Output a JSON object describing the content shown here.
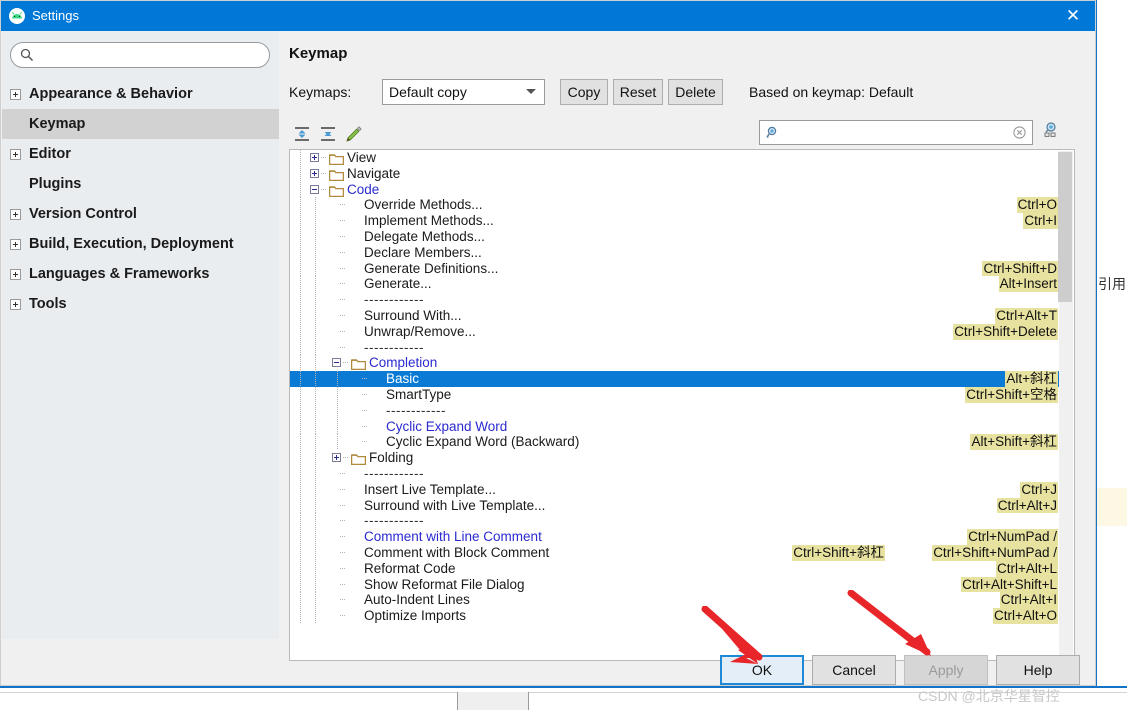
{
  "window": {
    "title": "Settings",
    "app_icon": "android-studio-icon",
    "close_label": "✕"
  },
  "sidebar": {
    "search": {
      "value": "",
      "placeholder": "",
      "icon": "search-icon"
    },
    "items": [
      {
        "label": "Appearance & Behavior",
        "expandable": true,
        "selected": false
      },
      {
        "label": "Keymap",
        "expandable": false,
        "selected": true
      },
      {
        "label": "Editor",
        "expandable": true,
        "selected": false
      },
      {
        "label": "Plugins",
        "expandable": false,
        "selected": false
      },
      {
        "label": "Version Control",
        "expandable": true,
        "selected": false
      },
      {
        "label": "Build, Execution, Deployment",
        "expandable": true,
        "selected": false
      },
      {
        "label": "Languages & Frameworks",
        "expandable": true,
        "selected": false
      },
      {
        "label": "Tools",
        "expandable": true,
        "selected": false
      }
    ]
  },
  "main": {
    "title": "Keymap",
    "keymaps_label": "Keymaps:",
    "keymap_selected": "Default copy",
    "buttons": {
      "copy": "Copy",
      "reset": "Reset",
      "delete": "Delete"
    },
    "based_on": "Based on keymap: Default",
    "toolbar_icons": [
      "expand-all-icon",
      "collapse-all-icon",
      "edit-shortcut-icon"
    ],
    "find": {
      "value": "",
      "placeholder": "",
      "icon": "find-shortcut-icon",
      "clear_icon": "clear-icon",
      "filter_icon": "filter-by-shortcut-icon"
    }
  },
  "tree": {
    "rows": [
      {
        "kind": "folder",
        "label": "View",
        "depth": 1,
        "toggle": "plus",
        "color": "dark",
        "shortcut": ""
      },
      {
        "kind": "folder",
        "label": "Navigate",
        "depth": 1,
        "toggle": "plus",
        "color": "dark",
        "shortcut": ""
      },
      {
        "kind": "folder",
        "label": "Code",
        "depth": 1,
        "toggle": "minus",
        "color": "blue",
        "shortcut": ""
      },
      {
        "kind": "item",
        "label": "Override Methods...",
        "depth": 2,
        "toggle": "",
        "color": "dark",
        "shortcut": "Ctrl+O"
      },
      {
        "kind": "item",
        "label": "Implement Methods...",
        "depth": 2,
        "toggle": "",
        "color": "dark",
        "shortcut": "Ctrl+I"
      },
      {
        "kind": "item",
        "label": "Delegate Methods...",
        "depth": 2,
        "toggle": "",
        "color": "dark",
        "shortcut": ""
      },
      {
        "kind": "item",
        "label": "Declare Members...",
        "depth": 2,
        "toggle": "",
        "color": "dark",
        "shortcut": ""
      },
      {
        "kind": "item",
        "label": "Generate Definitions...",
        "depth": 2,
        "toggle": "",
        "color": "dark",
        "shortcut": "Ctrl+Shift+D"
      },
      {
        "kind": "item",
        "label": "Generate...",
        "depth": 2,
        "toggle": "",
        "color": "dark",
        "shortcut": "Alt+Insert"
      },
      {
        "kind": "sep",
        "label": "------------",
        "depth": 2,
        "toggle": "",
        "color": "dark",
        "shortcut": ""
      },
      {
        "kind": "item",
        "label": "Surround With...",
        "depth": 2,
        "toggle": "",
        "color": "dark",
        "shortcut": "Ctrl+Alt+T"
      },
      {
        "kind": "item",
        "label": "Unwrap/Remove...",
        "depth": 2,
        "toggle": "",
        "color": "dark",
        "shortcut": "Ctrl+Shift+Delete"
      },
      {
        "kind": "sep",
        "label": "------------",
        "depth": 2,
        "toggle": "",
        "color": "dark",
        "shortcut": ""
      },
      {
        "kind": "folder",
        "label": "Completion",
        "depth": 2,
        "toggle": "minus",
        "color": "blue",
        "shortcut": ""
      },
      {
        "kind": "item",
        "label": "Basic",
        "depth": 3,
        "toggle": "",
        "color": "sel",
        "shortcut": "Alt+斜杠",
        "selected": true
      },
      {
        "kind": "item",
        "label": "SmartType",
        "depth": 3,
        "toggle": "",
        "color": "dark",
        "shortcut": "Ctrl+Shift+空格"
      },
      {
        "kind": "sep",
        "label": "------------",
        "depth": 3,
        "toggle": "",
        "color": "dark",
        "shortcut": ""
      },
      {
        "kind": "item",
        "label": "Cyclic Expand Word",
        "depth": 3,
        "toggle": "",
        "color": "blue",
        "shortcut": ""
      },
      {
        "kind": "item",
        "label": "Cyclic Expand Word (Backward)",
        "depth": 3,
        "toggle": "",
        "color": "dark",
        "shortcut": "Alt+Shift+斜杠"
      },
      {
        "kind": "folder",
        "label": "Folding",
        "depth": 2,
        "toggle": "plus",
        "color": "dark",
        "shortcut": ""
      },
      {
        "kind": "sep",
        "label": "------------",
        "depth": 2,
        "toggle": "",
        "color": "dark",
        "shortcut": ""
      },
      {
        "kind": "item",
        "label": "Insert Live Template...",
        "depth": 2,
        "toggle": "",
        "color": "dark",
        "shortcut": "Ctrl+J"
      },
      {
        "kind": "item",
        "label": "Surround with Live Template...",
        "depth": 2,
        "toggle": "",
        "color": "dark",
        "shortcut": "Ctrl+Alt+J"
      },
      {
        "kind": "sep",
        "label": "------------",
        "depth": 2,
        "toggle": "",
        "color": "dark",
        "shortcut": ""
      },
      {
        "kind": "item",
        "label": "Comment with Line Comment",
        "depth": 2,
        "toggle": "",
        "color": "blue",
        "shortcut": "Ctrl+NumPad /",
        "shortcut2": ""
      },
      {
        "kind": "item",
        "label": "Comment with Block Comment",
        "depth": 2,
        "toggle": "",
        "color": "dark",
        "shortcut": "Ctrl+Shift+NumPad /",
        "shortcut2": "Ctrl+Shift+斜杠"
      },
      {
        "kind": "item",
        "label": "Reformat Code",
        "depth": 2,
        "toggle": "",
        "color": "dark",
        "shortcut": "Ctrl+Alt+L"
      },
      {
        "kind": "item",
        "label": "Show Reformat File Dialog",
        "depth": 2,
        "toggle": "",
        "color": "dark",
        "shortcut": "Ctrl+Alt+Shift+L"
      },
      {
        "kind": "item",
        "label": "Auto-Indent Lines",
        "depth": 2,
        "toggle": "",
        "color": "dark",
        "shortcut": "Ctrl+Alt+I"
      },
      {
        "kind": "item",
        "label": "Optimize Imports",
        "depth": 2,
        "toggle": "",
        "color": "dark",
        "shortcut": "Ctrl+Alt+O"
      }
    ]
  },
  "footer": {
    "ok": "OK",
    "cancel": "Cancel",
    "apply": "Apply",
    "help": "Help"
  },
  "overlay": {
    "watermark": "CSDN @北京华星智控",
    "side_text": "引用",
    "arrow_color": "#e8262a"
  },
  "colors": {
    "titlebar": "#0078d7",
    "selection": "#0a7ad4",
    "shortcut_highlight": "#e8e2a0",
    "sidebar_bg": "#e9edf0",
    "dialog_bg": "#f0f0f0",
    "link_blue": "#2a2ad0"
  }
}
